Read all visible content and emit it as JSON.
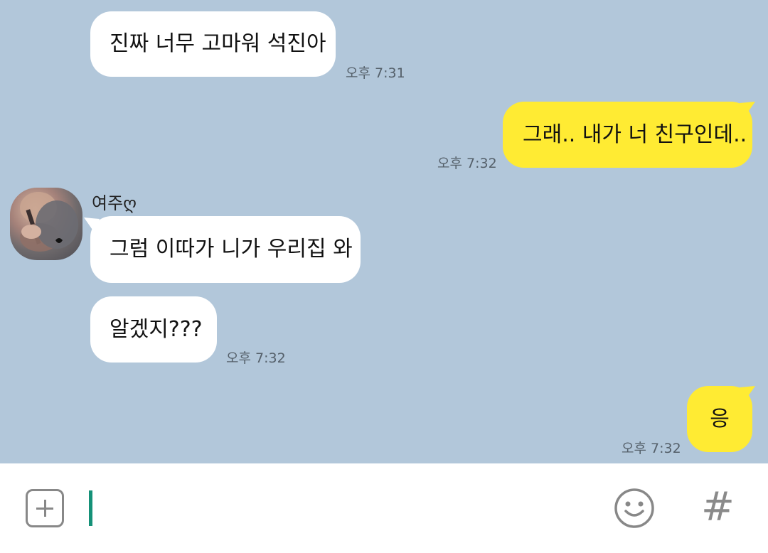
{
  "messages": [
    {
      "text": "진짜 너무 고마워 석진아",
      "time": "오후 7:31"
    },
    {
      "text": "그래.. 내가 너 친구인데..",
      "time": "오후 7:32"
    },
    {
      "sender": "여주ღ",
      "text": "그럼 이따가 니가 우리집 와"
    },
    {
      "text": "알겠지???",
      "time": "오후 7:32"
    },
    {
      "text": "응",
      "time": "오후 7:32"
    }
  ],
  "input": {
    "value": ""
  },
  "icons": {
    "add": "plus-square-icon",
    "emoji": "smiley-icon",
    "hashtag": "hashtag-icon"
  },
  "colors": {
    "background": "#b2c7da",
    "incoming": "#ffffff",
    "outgoing": "#ffeb33",
    "caret": "#159178"
  },
  "hash_glyph": "#"
}
